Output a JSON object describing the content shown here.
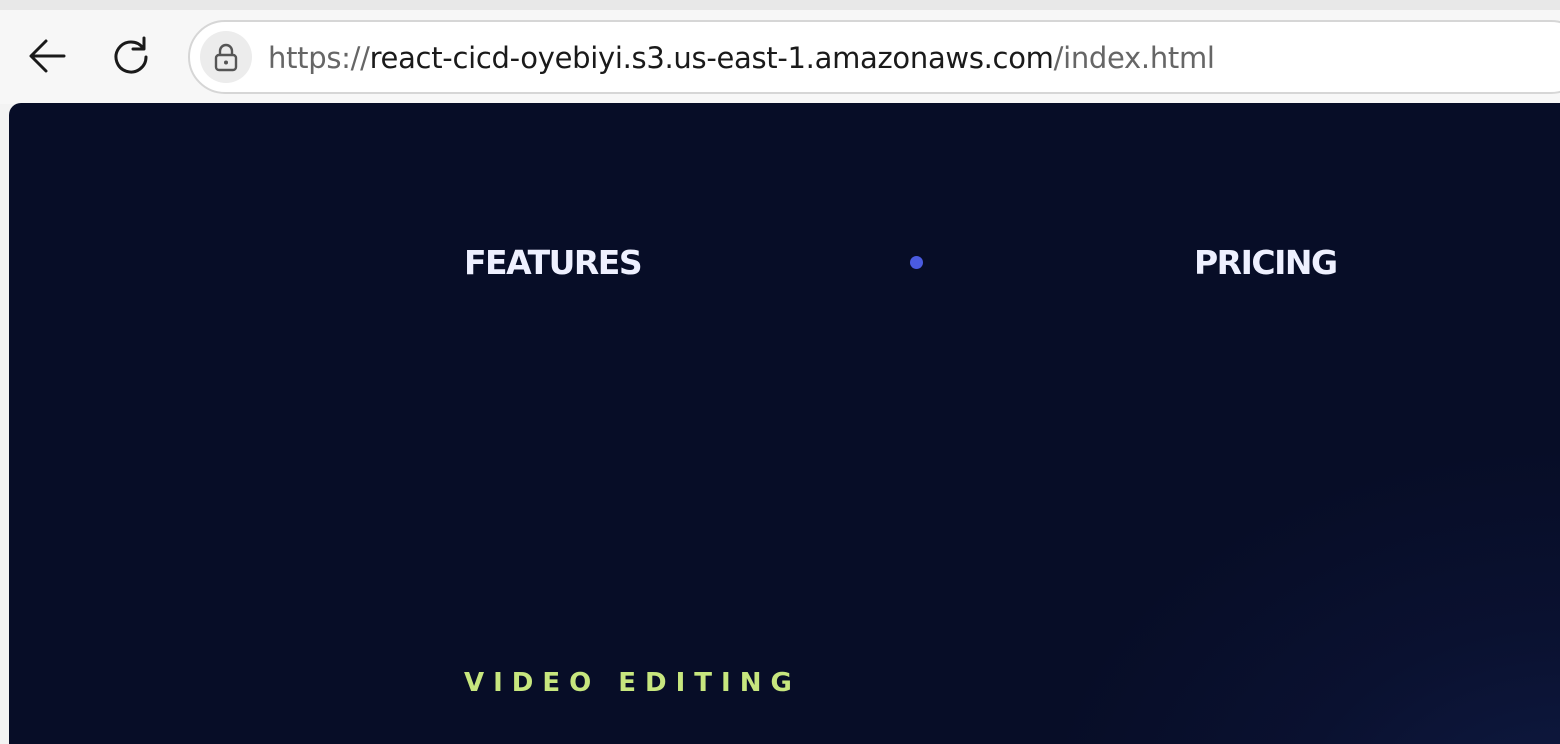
{
  "browser": {
    "url": {
      "scheme": "https://",
      "host": "react-cicd-oyebiyi.s3.us-east-1.amazonaws.com",
      "path": "/index.html"
    },
    "icons": {
      "back": "back-arrow-icon",
      "reload": "reload-icon",
      "security": "lock-icon"
    }
  },
  "page": {
    "nav": {
      "features_label": "FEATURES",
      "pricing_label": "PRICING",
      "separator_color": "#4a5be0"
    },
    "section_label": "VIDEO EDITING",
    "colors": {
      "background": "#070d27",
      "nav_text": "#eef0ff",
      "accent_green": "#c7e67e"
    }
  }
}
